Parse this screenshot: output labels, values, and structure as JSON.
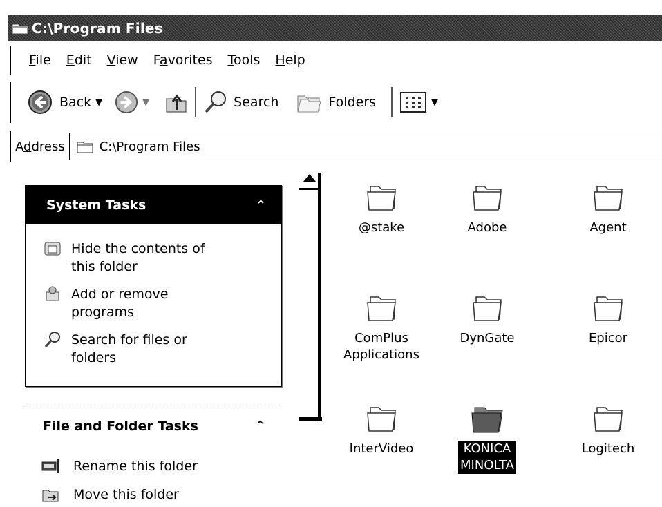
{
  "window": {
    "title": "C:\\Program Files",
    "icon": "folder-icon"
  },
  "menu": {
    "file": "File",
    "edit": "Edit",
    "view": "View",
    "favorites": "Favorites",
    "tools": "Tools",
    "help": "Help"
  },
  "toolbar": {
    "back": "Back",
    "search": "Search",
    "folders": "Folders"
  },
  "address": {
    "label": "Address",
    "value": "C:\\Program Files"
  },
  "system_tasks": {
    "header": "System Tasks",
    "items": [
      {
        "line1": "Hide the contents of",
        "line2": "this folder",
        "icon": "hide-contents-icon"
      },
      {
        "line1": "Add or remove",
        "line2": "programs",
        "icon": "add-remove-programs-icon"
      },
      {
        "line1": "Search for files or",
        "line2": "folders",
        "icon": "search-icon"
      }
    ]
  },
  "file_folder_tasks": {
    "header": "File and Folder Tasks",
    "items": [
      {
        "label": "Rename this folder",
        "icon": "rename-icon"
      },
      {
        "label": "Move this folder",
        "icon": "move-icon"
      }
    ]
  },
  "folders": [
    {
      "line1": "@stake",
      "line2": ""
    },
    {
      "line1": "Adobe",
      "line2": ""
    },
    {
      "line1": "Agent",
      "line2": ""
    },
    {
      "line1": "ComPlus",
      "line2": "Applications"
    },
    {
      "line1": "DynGate",
      "line2": ""
    },
    {
      "line1": "Epicor",
      "line2": ""
    },
    {
      "line1": "InterVideo",
      "line2": ""
    },
    {
      "line1": "KONICA",
      "line2": "MINOLTA"
    },
    {
      "line1": "Logitech",
      "line2": ""
    }
  ],
  "selected_folder_index": 7
}
